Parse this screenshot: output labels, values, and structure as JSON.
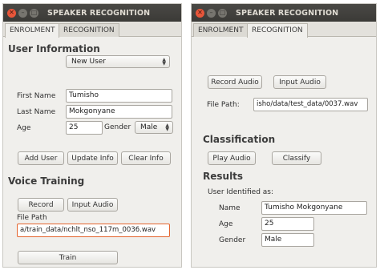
{
  "left": {
    "title": "SPEAKER RECOGNITION",
    "tabs": [
      "ENROLMENT",
      "RECOGNITION"
    ],
    "user_info_heading": "User Information",
    "user_select": "New User",
    "first_name_label": "First Name",
    "first_name_value": "Tumisho",
    "last_name_label": "Last Name",
    "last_name_value": "Mokgonyane",
    "age_label": "Age",
    "age_value": "25",
    "gender_label": "Gender",
    "gender_value": "Male",
    "add_user": "Add User",
    "update_info": "Update Info",
    "clear_info": "Clear Info",
    "voice_training_heading": "Voice Training",
    "record": "Record",
    "input_audio": "Input Audio",
    "file_path_label": "File Path",
    "file_path_value": "a/train_data/nchlt_nso_117m_0036.wav",
    "train": "Train"
  },
  "right": {
    "title": "SPEAKER RECOGNITION",
    "tabs": [
      "ENROLMENT",
      "RECOGNITION"
    ],
    "record_audio": "Record Audio",
    "input_audio": "Input Audio",
    "file_path_label": "File Path:",
    "file_path_value": "isho/data/test_data/0037.wav",
    "classification_heading": "Classification",
    "play_audio": "Play Audio",
    "classify": "Classify",
    "results_heading": "Results",
    "user_identified_label": "User Identified as:",
    "name_label": "Name",
    "name_value": "Tumisho Mokgonyane",
    "age_label": "Age",
    "age_value": "25",
    "gender_label": "Gender",
    "gender_value": "Male"
  },
  "colors": {
    "titlebar": "#3b3a37",
    "close_button": "#e8563a",
    "focus_border": "#e4652f",
    "window_bg": "#f0efec"
  }
}
